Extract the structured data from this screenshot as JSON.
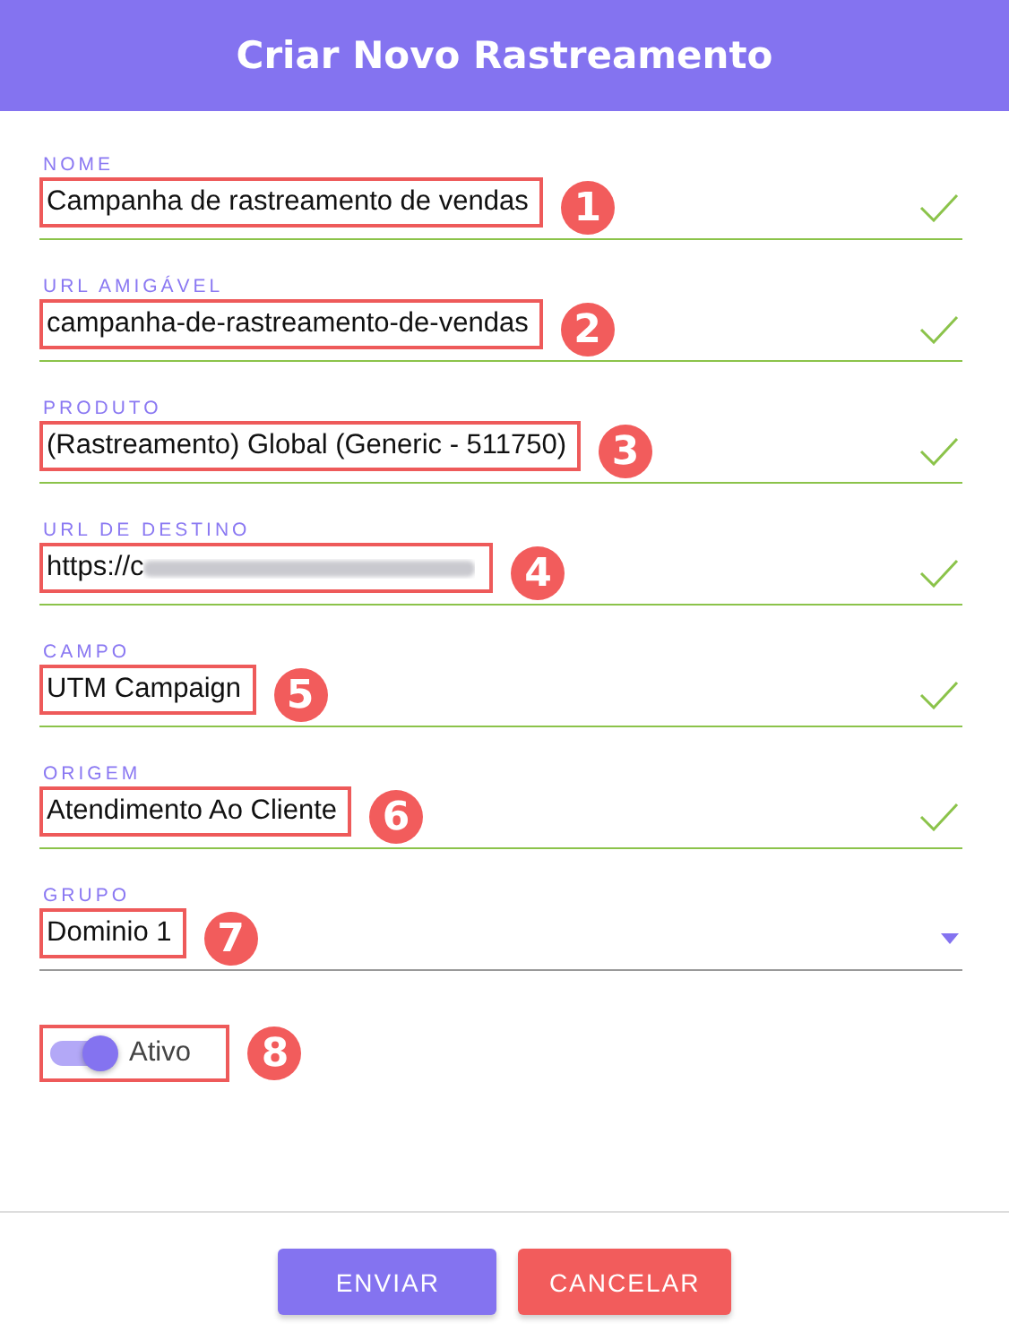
{
  "dialog": {
    "title": "Criar Novo Rastreamento"
  },
  "fields": [
    {
      "kind": "text",
      "label": "NOME",
      "value": "Campanha de rastreamento de vendas",
      "valid": true,
      "callout": "1"
    },
    {
      "kind": "text",
      "label": "URL AMIGÁVEL",
      "value": "campanha-de-rastreamento-de-vendas",
      "valid": true,
      "callout": "2"
    },
    {
      "kind": "text",
      "label": "PRODUTO",
      "value": "(Rastreamento) Global (Generic - 511750)",
      "valid": true,
      "callout": "3"
    },
    {
      "kind": "text",
      "label": "URL DE DESTINO",
      "value": "https://c",
      "valid": true,
      "blurred": true,
      "callout": "4"
    },
    {
      "kind": "text",
      "label": "CAMPO",
      "value": "UTM Campaign",
      "valid": true,
      "callout": "5"
    },
    {
      "kind": "text",
      "label": "ORIGEM",
      "value": "Atendimento Ao Cliente",
      "valid": true,
      "callout": "6"
    },
    {
      "kind": "select",
      "label": "GRUPO",
      "value": "Dominio 1",
      "valid": false,
      "callout": "7"
    }
  ],
  "toggle": {
    "label": "Ativo",
    "on": true,
    "callout": "8"
  },
  "buttons": [
    {
      "label": "ENVIAR",
      "kind": "primary"
    },
    {
      "label": "CANCELAR",
      "kind": "danger"
    }
  ]
}
